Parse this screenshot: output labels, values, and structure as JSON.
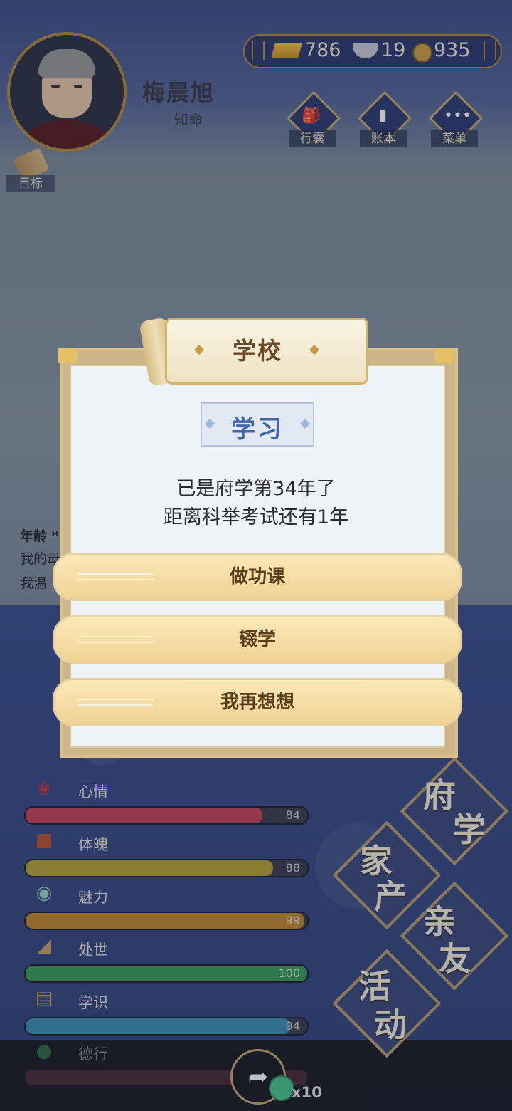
{
  "player": {
    "name": "梅晨旭",
    "title": "知命"
  },
  "hud": {
    "goal_label": "目标",
    "currency": {
      "gold": "786",
      "silver": "19",
      "coin": "935"
    },
    "menu": [
      {
        "label": "行囊"
      },
      {
        "label": "账本"
      },
      {
        "label": "菜单"
      }
    ]
  },
  "background_text": {
    "age_label": "年龄 ᴴ",
    "line1": "我的母",
    "line2": "我温"
  },
  "stats": [
    {
      "label": "心情",
      "value": 84,
      "color": "#c8455a",
      "icon": "hibiscus-icon"
    },
    {
      "label": "体魄",
      "value": 88,
      "color": "#b5a437",
      "icon": "drum-icon"
    },
    {
      "label": "魅力",
      "value": 99,
      "color": "#c0892e",
      "icon": "jade-disc-icon"
    },
    {
      "label": "处世",
      "value": 100,
      "color": "#3a9e5a",
      "icon": "fan-icon"
    },
    {
      "label": "学识",
      "value": 94,
      "color": "#3d8fb6",
      "icon": "book-icon"
    },
    {
      "label": "德行",
      "value": 100,
      "color": "#4a2c3a",
      "icon": "incense-icon"
    }
  ],
  "big_buttons": [
    {
      "line1": "府",
      "line2": "学"
    },
    {
      "line1": "家",
      "line2": "产"
    },
    {
      "line1": "亲",
      "line2": "友"
    },
    {
      "line1": "活",
      "line2": "动"
    }
  ],
  "dock": {
    "multiplier": "x10"
  },
  "modal": {
    "title": "学校",
    "tag": "学习",
    "message_line1": "已是府学第34年了",
    "message_line2": "距离科举考试还有1年",
    "options": [
      "做功课",
      "辍学",
      "我再想想"
    ]
  }
}
